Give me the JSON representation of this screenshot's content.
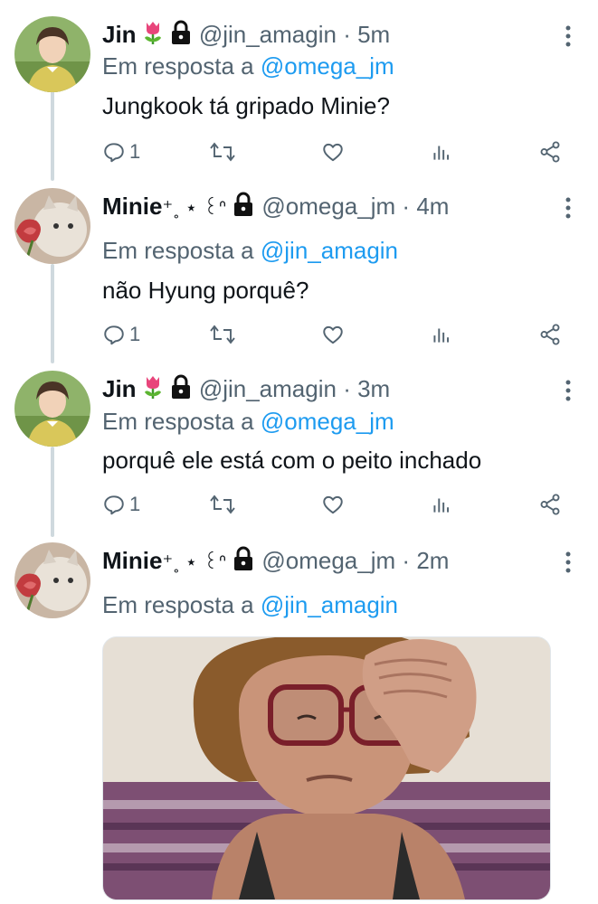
{
  "tweets": [
    {
      "name": "Jin",
      "name_emojis": [
        "tulip-icon",
        "lock-icon"
      ],
      "handle": "@jin_amagin",
      "separator": "·",
      "time": "5m",
      "reply_prefix": "Em resposta a",
      "reply_to": "@omega_jm",
      "text": "Jungkook tá gripado Minie?",
      "reply_count": "1"
    },
    {
      "name": "Minie",
      "name_suffix": "⁺˳ ⋆ ꒰ᐢ",
      "name_emojis": [
        "lock-icon"
      ],
      "handle": "@omega_jm",
      "separator": "·",
      "time": "4m",
      "reply_prefix": "Em resposta a",
      "reply_to": "@jin_amagin",
      "text": "não Hyung porquê?",
      "reply_count": "1"
    },
    {
      "name": "Jin",
      "name_emojis": [
        "tulip-icon",
        "lock-icon"
      ],
      "handle": "@jin_amagin",
      "separator": "·",
      "time": "3m",
      "reply_prefix": "Em resposta a",
      "reply_to": "@omega_jm",
      "text": "porquê ele está com o peito inchado",
      "reply_count": "1"
    },
    {
      "name": "Minie",
      "name_suffix": "⁺˳ ⋆ ꒰ᐢ",
      "name_emojis": [
        "lock-icon"
      ],
      "handle": "@omega_jm",
      "separator": "·",
      "time": "2m",
      "reply_prefix": "Em resposta a",
      "reply_to": "@jin_amagin",
      "media": "photo-elderly-woman-hand-on-forehead"
    }
  ],
  "icons": [
    "comment-icon",
    "retweet-icon",
    "like-icon",
    "analytics-icon",
    "share-icon",
    "more-icon"
  ],
  "colors": {
    "text": "#0f1419",
    "secondary": "#536471",
    "link": "#1d9bf0",
    "thread": "#cfd9de"
  }
}
